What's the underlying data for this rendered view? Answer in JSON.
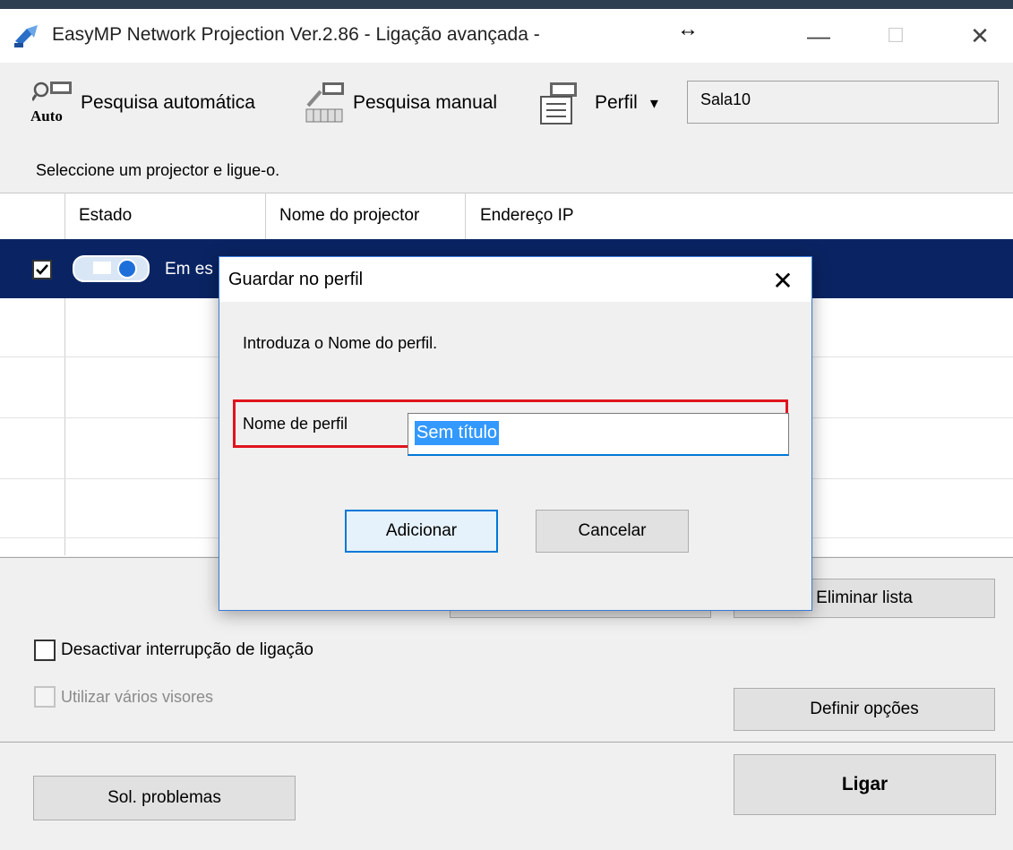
{
  "window": {
    "title": "EasyMP Network Projection Ver.2.86 - Ligação avançada -",
    "resize_glyph": "↔",
    "minimize_glyph": "—",
    "maximize_glyph": "☐",
    "close_glyph": "✕"
  },
  "toolbar": {
    "auto_search_label": "Pesquisa automática",
    "auto_badge": "Auto",
    "manual_search_label": "Pesquisa manual",
    "profile_label": "Perfil",
    "profile_dropdown_glyph": "▾",
    "profile_value": "Sala10"
  },
  "instruction": "Seleccione um projector e ligue-o.",
  "table": {
    "columns": [
      "Estado",
      "Nome do projector",
      "Endereço IP"
    ],
    "rows": [
      {
        "checked": true,
        "status": "Em es"
      }
    ]
  },
  "bottom": {
    "delete_list_label": "Eliminar lista",
    "disable_interrupt_label": "Desactivar interrupção de ligação",
    "multi_display_label": "Utilizar vários visores",
    "set_options_label": "Definir opções",
    "troubleshoot_label": "Sol. problemas",
    "connect_label": "Ligar"
  },
  "dialog": {
    "title": "Guardar no perfil",
    "close_glyph": "✕",
    "prompt": "Introduza o Nome do perfil.",
    "field_label": "Nome de perfil",
    "field_value": "Sem título",
    "add_label": "Adicionar",
    "cancel_label": "Cancelar"
  },
  "colors": {
    "selection": "#0a2463",
    "highlight_border": "#e0141e",
    "dialog_border": "#3a7bd5",
    "text_selection": "#3399ff"
  }
}
